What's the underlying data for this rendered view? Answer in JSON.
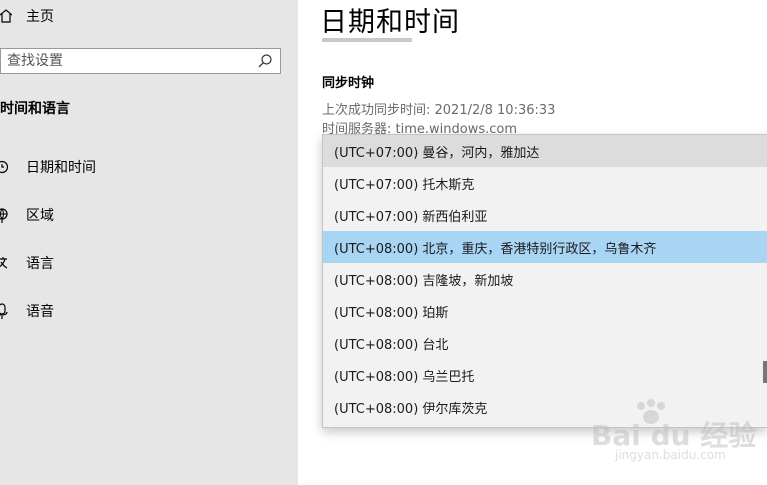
{
  "sidebar": {
    "home_label": "主页",
    "search_placeholder": "查找设置",
    "section_title": "时间和语言",
    "items": [
      {
        "label": "日期和时间"
      },
      {
        "label": "区域"
      },
      {
        "label": "语言"
      },
      {
        "label": "语音"
      }
    ]
  },
  "main": {
    "title": "日期和时间",
    "sync_heading": "同步时钟",
    "last_sync": "上次成功同步时间: 2021/2/8 10:36:33",
    "time_server": "时间服务器: time.windows.com"
  },
  "timezone_dropdown": {
    "options": [
      "(UTC+07:00) 曼谷，河内，雅加达",
      "(UTC+07:00) 托木斯克",
      "(UTC+07:00) 新西伯利亚",
      "(UTC+08:00) 北京，重庆，香港特别行政区，乌鲁木齐",
      "(UTC+08:00) 吉隆坡，新加坡",
      "(UTC+08:00) 珀斯",
      "(UTC+08:00) 台北",
      "(UTC+08:00) 乌兰巴托",
      "(UTC+08:00) 伊尔库茨克"
    ],
    "selected_index": 3,
    "hover_index": 0
  },
  "watermark": {
    "brand": "Bai du 经验",
    "url": "jingyan.baidu.com"
  },
  "colors": {
    "sidebar_bg": "#e6e6e6",
    "selected_bg": "#a9d5f5",
    "hover_bg": "#dcdcdc",
    "dropdown_bg": "#f2f2f2"
  }
}
